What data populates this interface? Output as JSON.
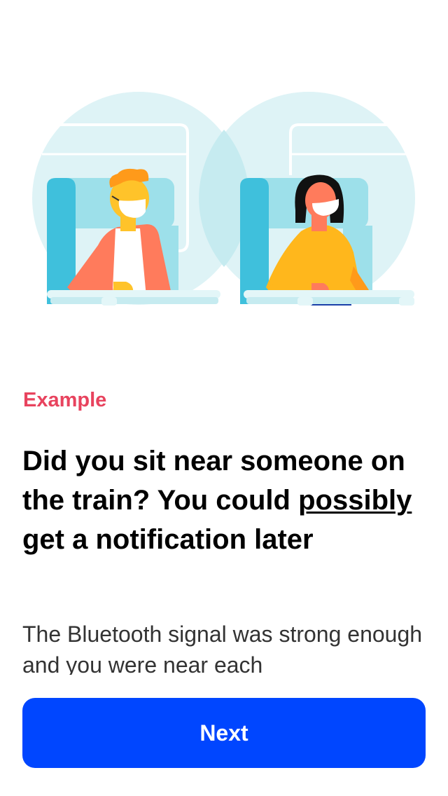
{
  "onboarding": {
    "label": "Example",
    "headline_part1": "Did you sit near someone on the train? You could ",
    "headline_emph": "possibly",
    "headline_part2": " get a notification later",
    "body": "The Bluetooth signal was strong enough and you were near each",
    "next_label": "Next"
  },
  "colors": {
    "accent": "#e8435e",
    "button": "#0046ff",
    "circle": "#def3f6",
    "seat": "#9de0ea",
    "seat_dark": "#3fc0dc",
    "shirt_red": "#ff7b5c",
    "shirt_yellow": "#ffb71c",
    "skin": "#ffc32a"
  }
}
